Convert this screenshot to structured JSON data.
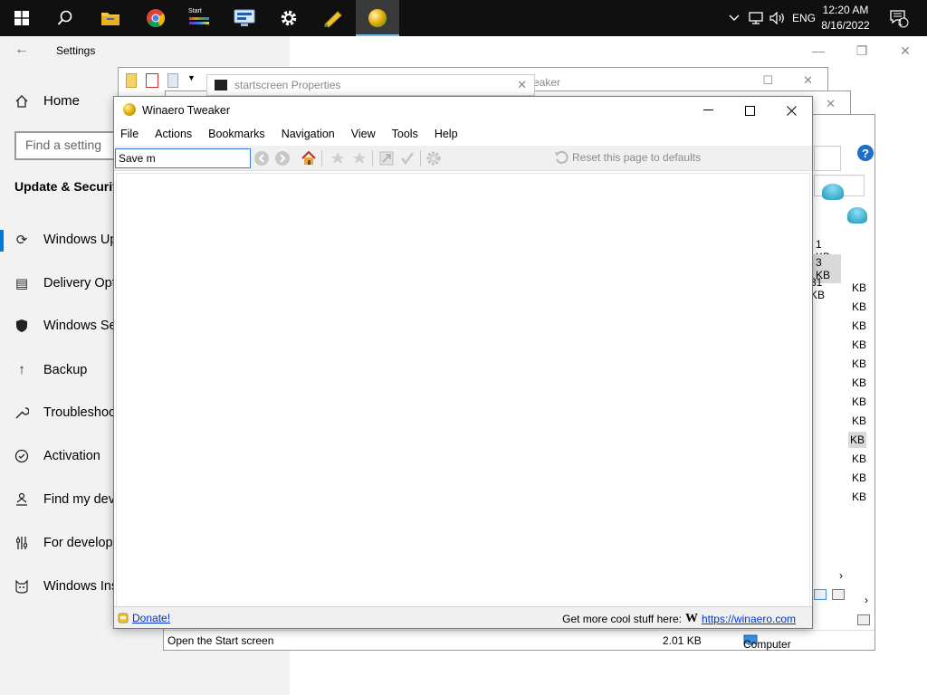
{
  "taskbar": {
    "clock_time": "12:20 AM",
    "clock_date": "8/16/2022",
    "lang": "ENG",
    "notif_count": "1",
    "start_label": "Start"
  },
  "settings": {
    "title": "Settings",
    "home": "Home",
    "search_placeholder": "Find a setting",
    "section": "Update & Security",
    "items": [
      {
        "label": "Windows Update",
        "icon": "sync-icon"
      },
      {
        "label": "Delivery Optimization",
        "icon": "delivery-icon"
      },
      {
        "label": "Windows Security",
        "icon": "shield-icon"
      },
      {
        "label": "Backup",
        "icon": "backup-arrow-icon"
      },
      {
        "label": "Troubleshoot",
        "icon": "wrench-icon"
      },
      {
        "label": "Activation",
        "icon": "check-circle-icon"
      },
      {
        "label": "Find my device",
        "icon": "person-location-icon"
      },
      {
        "label": "For developers",
        "icon": "developer-icon"
      },
      {
        "label": "Windows Insider Program",
        "icon": "cat-icon"
      }
    ]
  },
  "explorer": {
    "properties_title": "startscreen Properties",
    "back_title_fragment": "eaker",
    "sizes_top": [
      "1 KB",
      "3 KB",
      "31 KB"
    ],
    "sizes_side": [
      "KB",
      "KB",
      "KB",
      "KB",
      "KB",
      "KB",
      "KB",
      "KB",
      "KB",
      "KB",
      "KB",
      "KB"
    ],
    "status_item": "Open the Start screen",
    "status_size": "2.01 KB",
    "status_location": "Computer"
  },
  "tweaker": {
    "title": "Winaero Tweaker",
    "menu": [
      "File",
      "Actions",
      "Bookmarks",
      "Navigation",
      "View",
      "Tools",
      "Help"
    ],
    "search_value": "Save m",
    "reset_label": "Reset this page to defaults",
    "donate_label": "Donate!",
    "cool_label": "Get more cool stuff here:",
    "site_logo": "W",
    "site_link": "https://winaero.com"
  }
}
